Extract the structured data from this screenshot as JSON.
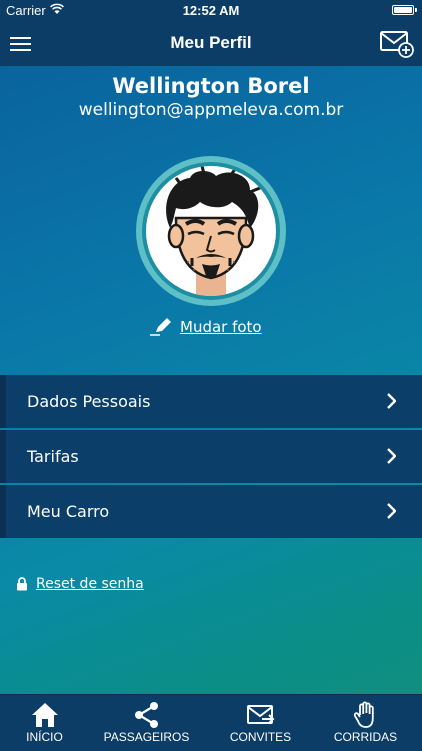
{
  "status_bar": {
    "carrier": "Carrier",
    "time": "12:52 AM"
  },
  "header": {
    "title": "Meu Perfil",
    "menu_icon": "hamburger-icon",
    "invite_icon": "mail-plus-icon"
  },
  "profile": {
    "name": "Wellington Borel",
    "email": "wellington@appmeleva.com.br",
    "change_photo_label": "Mudar foto"
  },
  "menu": {
    "items": [
      {
        "label": "Dados Pessoais"
      },
      {
        "label": "Tarifas"
      },
      {
        "label": "Meu Carro"
      }
    ]
  },
  "reset_password": {
    "label": "Reset de senha"
  },
  "tabs": [
    {
      "label": "INÍCIO",
      "icon": "home-icon"
    },
    {
      "label": "PASSAGEIROS",
      "icon": "share-icon"
    },
    {
      "label": "CONVITES",
      "icon": "mail-send-icon"
    },
    {
      "label": "CORRIDAS",
      "icon": "hand-icon"
    }
  ],
  "colors": {
    "bar": "#0b3d66",
    "item": "#0b3f69",
    "accent": "#5fbfc7"
  }
}
